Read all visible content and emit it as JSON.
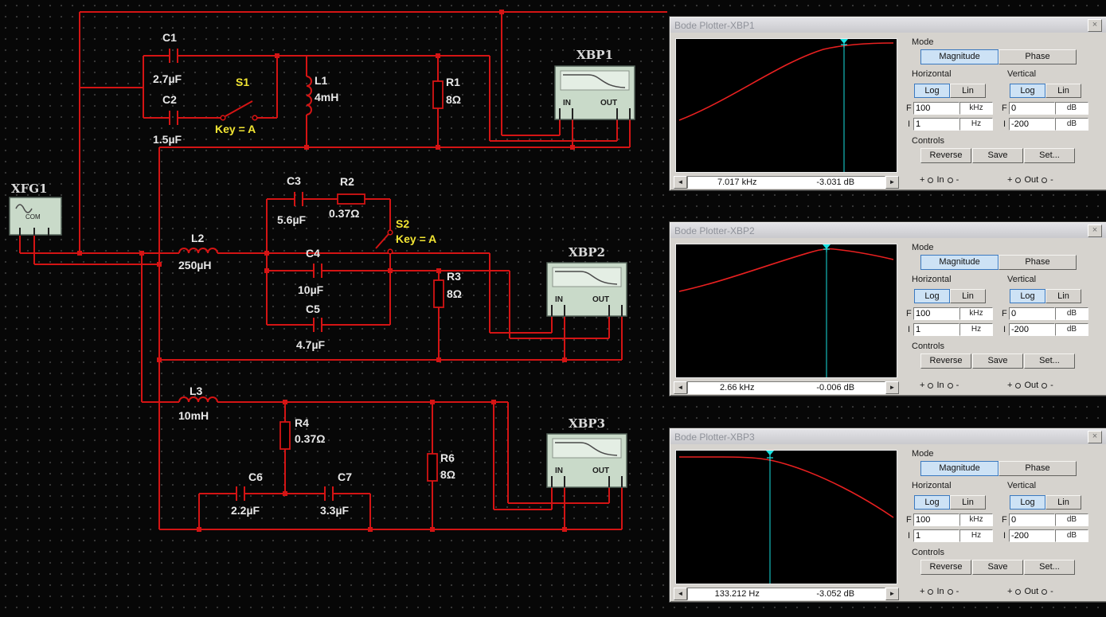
{
  "circuit": {
    "components": [
      {
        "ref": "C1",
        "value": "2.7µF"
      },
      {
        "ref": "C2",
        "value": "1.5µF"
      },
      {
        "ref": "S1",
        "value": "Key = A"
      },
      {
        "ref": "L1",
        "value": "4mH"
      },
      {
        "ref": "R1",
        "value": "8Ω"
      },
      {
        "ref": "L2",
        "value": "250µH"
      },
      {
        "ref": "C3",
        "value": "5.6µF"
      },
      {
        "ref": "R2",
        "value": "0.37Ω"
      },
      {
        "ref": "S2",
        "value": "Key = A"
      },
      {
        "ref": "C4",
        "value": "10µF"
      },
      {
        "ref": "C5",
        "value": "4.7µF"
      },
      {
        "ref": "R3",
        "value": "8Ω"
      },
      {
        "ref": "L3",
        "value": "10mH"
      },
      {
        "ref": "R4",
        "value": "0.37Ω"
      },
      {
        "ref": "C6",
        "value": "2.2µF"
      },
      {
        "ref": "C7",
        "value": "3.3µF"
      },
      {
        "ref": "R6",
        "value": "8Ω"
      }
    ],
    "instruments": [
      {
        "label": "XFG1"
      },
      {
        "label": "XBP1"
      },
      {
        "label": "XBP2"
      },
      {
        "label": "XBP3"
      }
    ],
    "icon_in": "IN",
    "icon_out": "OUT",
    "icon_com": "COM"
  },
  "bode": {
    "mode_label": "Mode",
    "magnitude": "Magnitude",
    "phase": "Phase",
    "horizontal": "Horizontal",
    "vertical": "Vertical",
    "log": "Log",
    "lin": "Lin",
    "f_label": "F",
    "i_label": "I",
    "h_f_value": "100",
    "h_f_unit": "kHz",
    "h_i_value": "1",
    "h_i_unit": "Hz",
    "v_f_value": "0",
    "v_f_unit": "dB",
    "v_i_value": "-200",
    "v_i_unit": "dB",
    "controls_label": "Controls",
    "reverse": "Reverse",
    "save": "Save",
    "set": "Set...",
    "plus": "+",
    "minus": "-",
    "in_label": "In",
    "out_label": "Out",
    "left_arrow": "◄",
    "right_arrow": "►",
    "close": "×"
  },
  "windows": [
    {
      "title": "Bode Plotter-XBP1",
      "cursor_freq": "7.017 kHz",
      "cursor_db": "-3.031 dB"
    },
    {
      "title": "Bode Plotter-XBP2",
      "cursor_freq": "2.66 kHz",
      "cursor_db": "-0.006 dB"
    },
    {
      "title": "Bode Plotter-XBP3",
      "cursor_freq": "133.212 Hz",
      "cursor_db": "-3.052 dB"
    }
  ]
}
